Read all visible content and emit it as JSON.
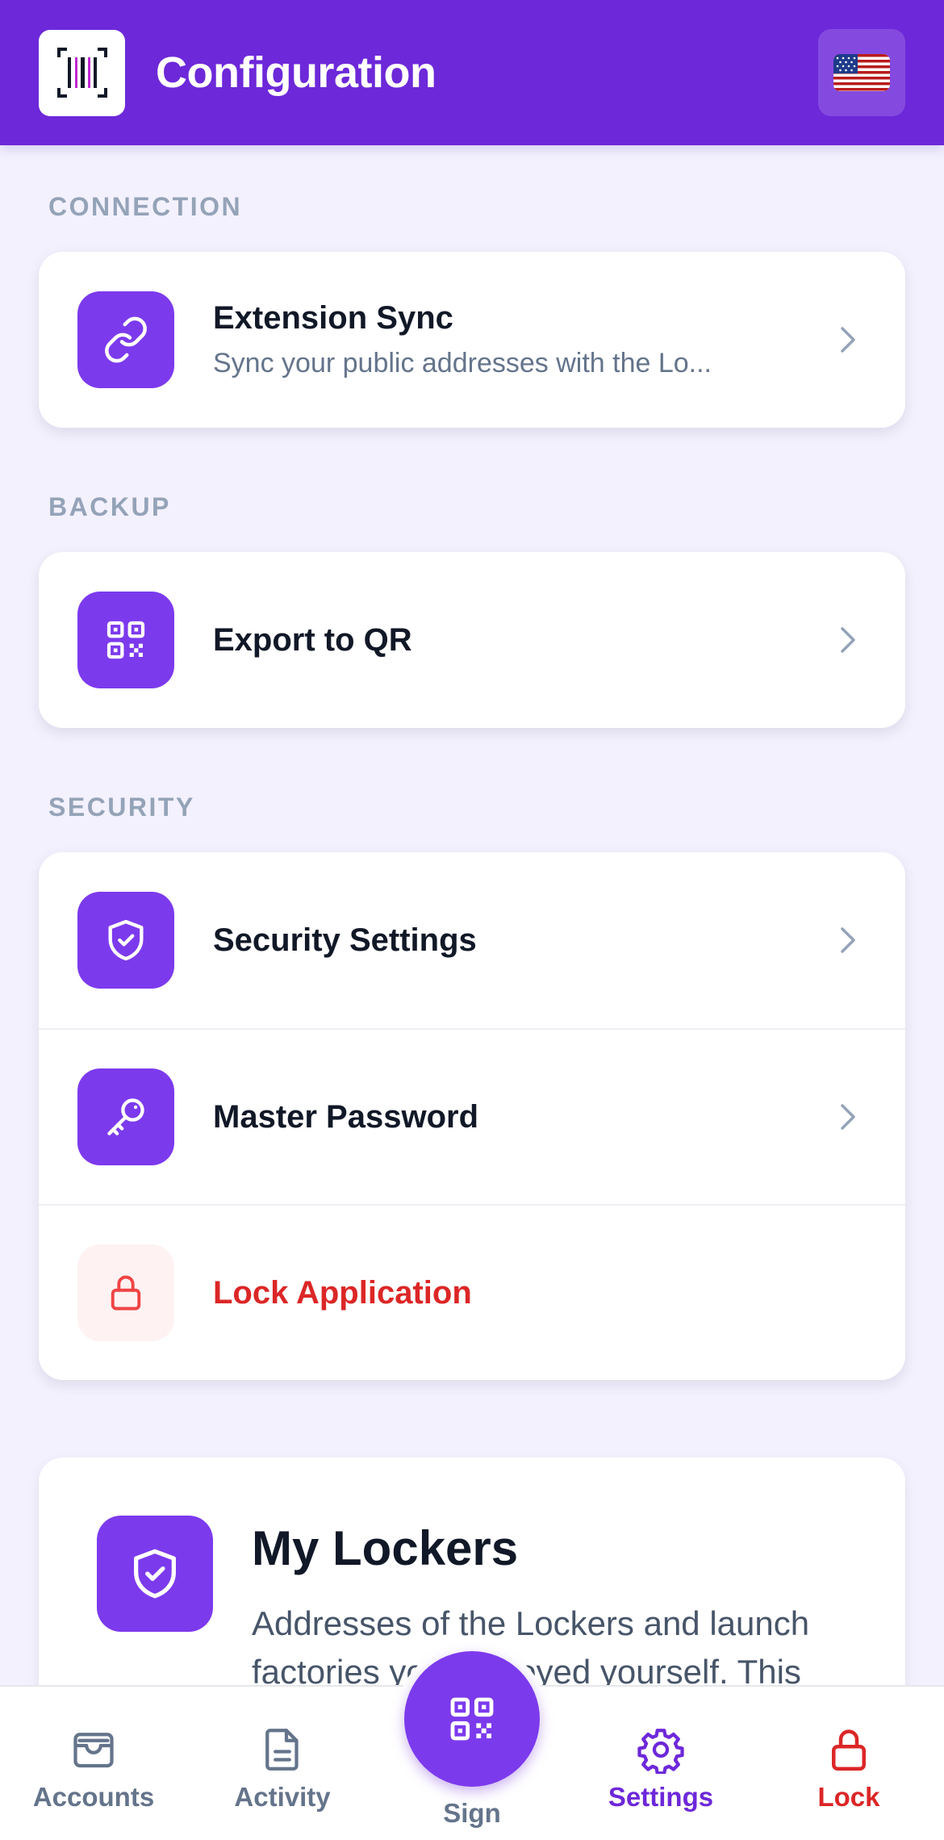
{
  "header": {
    "title": "Configuration",
    "logo_icon": "barcode-logo-icon",
    "language_icon": "us-flag-icon"
  },
  "sections": {
    "connection": {
      "label": "CONNECTION",
      "items": [
        {
          "title": "Extension Sync",
          "subtitle": "Sync your public addresses with the Lo...",
          "icon": "link-icon"
        }
      ]
    },
    "backup": {
      "label": "BACKUP",
      "items": [
        {
          "title": "Export to QR",
          "icon": "qr-code-icon"
        }
      ]
    },
    "security": {
      "label": "SECURITY",
      "items": [
        {
          "title": "Security Settings",
          "icon": "shield-check-icon"
        },
        {
          "title": "Master Password",
          "icon": "key-icon"
        },
        {
          "title": "Lock Application",
          "icon": "lock-icon"
        }
      ]
    }
  },
  "lockers": {
    "title": "My Lockers",
    "description": "Addresses of the Lockers and launch factories you deployed yourself. This"
  },
  "bottom_nav": {
    "items": [
      {
        "label": "Accounts",
        "icon": "wallet-icon"
      },
      {
        "label": "Activity",
        "icon": "document-icon"
      },
      {
        "label": "Sign",
        "icon": "qr-code-icon"
      },
      {
        "label": "Settings",
        "icon": "gear-icon"
      },
      {
        "label": "Lock",
        "icon": "lock-icon"
      }
    ],
    "active": "Settings"
  },
  "colors": {
    "primary": "#6d28d9",
    "accent": "#7c3aed",
    "danger": "#dc2626",
    "background": "#f3f1fd"
  }
}
